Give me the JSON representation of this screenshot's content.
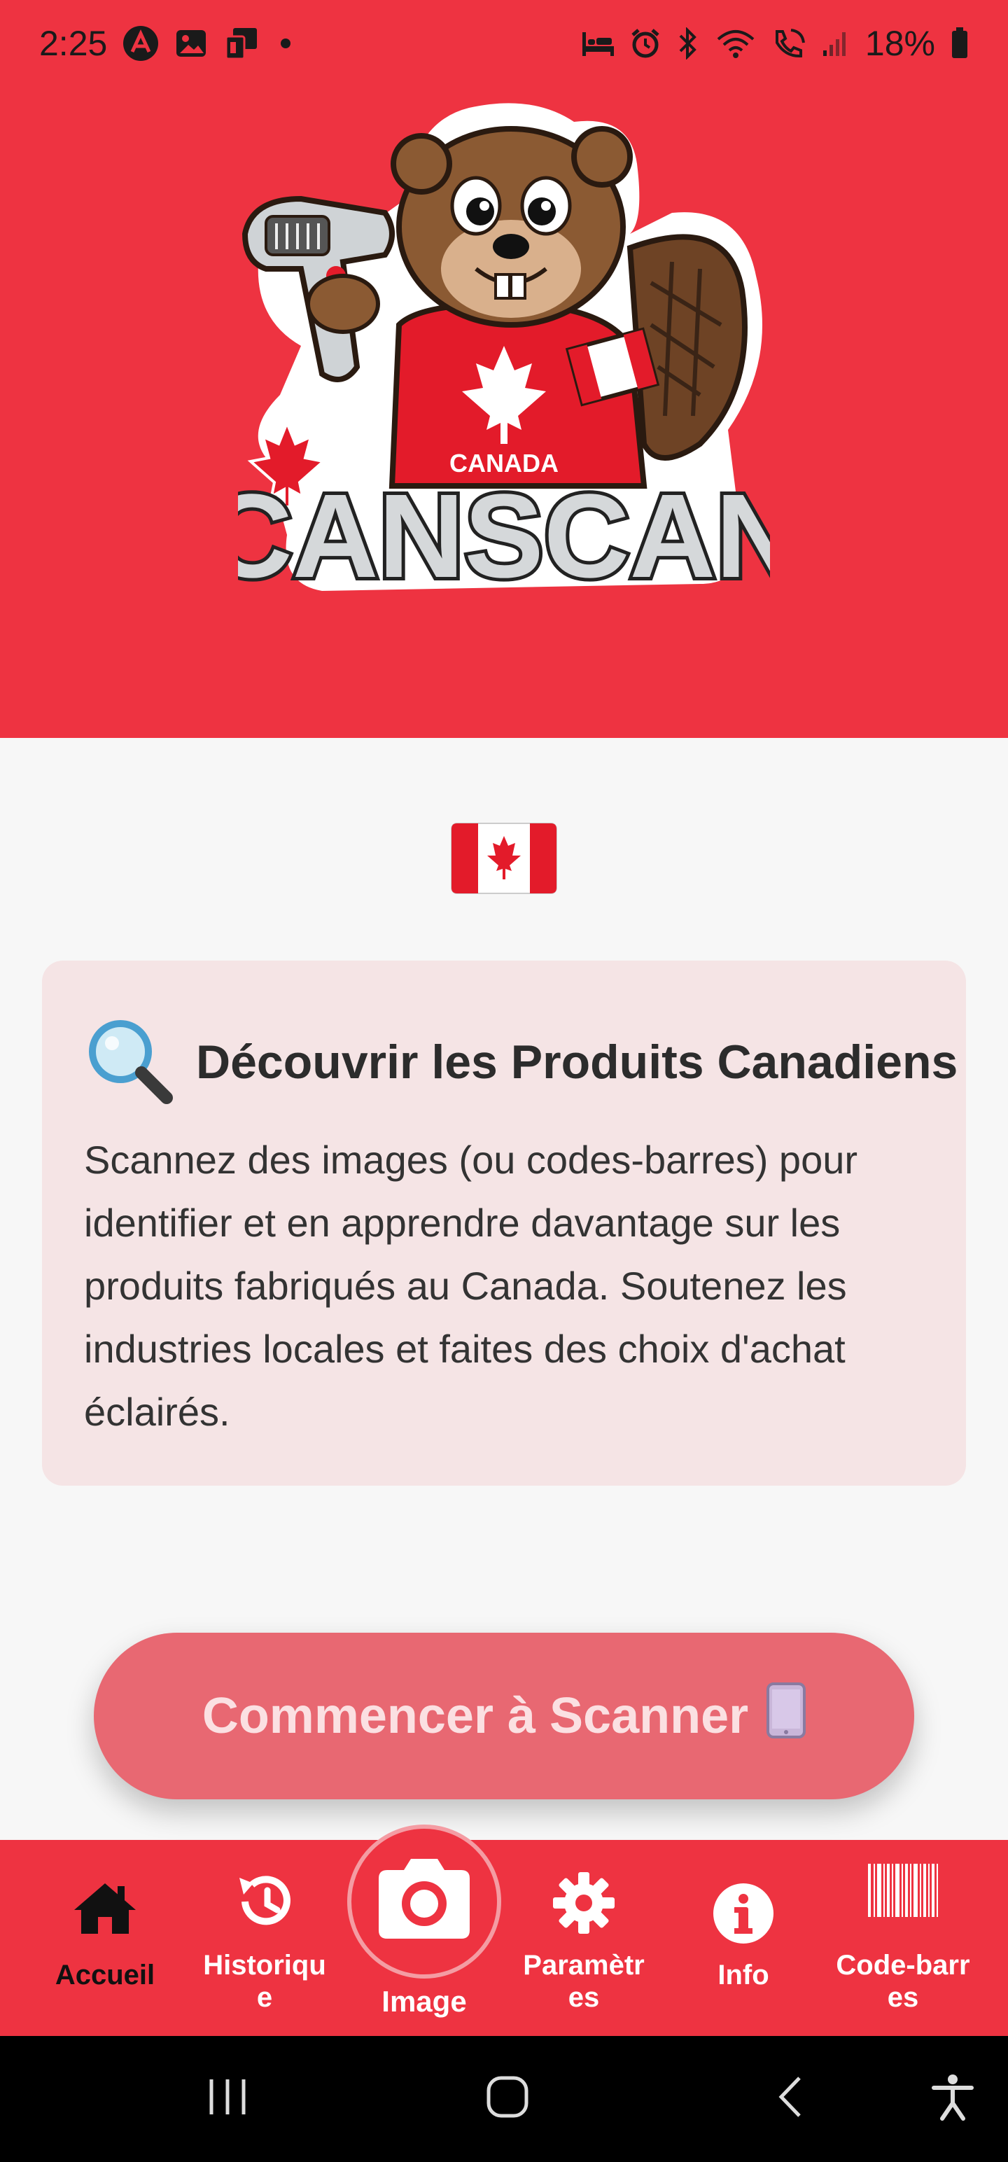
{
  "status_bar": {
    "time": "2:25",
    "battery": "18%",
    "icons_left": [
      "app-a-icon",
      "gallery-icon",
      "cast-icon",
      "dot-icon"
    ],
    "icons_right": [
      "bed-icon",
      "alarm-icon",
      "bluetooth-icon",
      "wifi-icon",
      "wifi-calling-icon",
      "signal-icon",
      "battery-icon"
    ]
  },
  "header": {
    "logo_text": "CANSCAN",
    "logo_shirt_text": "CANADA"
  },
  "card": {
    "icon": "magnifier-icon",
    "title": "Découvrir les Produits Canadiens",
    "body": "Scannez des images (ou codes-barres) pour identifier et en apprendre davantage sur les produits fabriqués au Canada. Soutenez les industries locales et faites des choix d'achat éclairés."
  },
  "cta": {
    "label": "Commencer à Scanner",
    "icon": "phone-icon"
  },
  "tabs": [
    {
      "label": "Accueil",
      "icon": "home-icon",
      "active": true
    },
    {
      "label": "Historique",
      "icon": "history-icon",
      "active": false
    },
    {
      "label": "Image",
      "icon": "camera-icon",
      "active": false
    },
    {
      "label": "Paramètres",
      "icon": "gear-icon",
      "active": false
    },
    {
      "label": "Info",
      "icon": "info-icon",
      "active": false
    },
    {
      "label": "Code-barres",
      "icon": "barcode-icon",
      "active": false
    }
  ],
  "tab_display": {
    "historique_l1": "Historiqu",
    "historique_l2": "e",
    "parametres_l1": "Paramètr",
    "parametres_l2": "es",
    "codebarres_l1": "Code-barr",
    "codebarres_l2": "es"
  },
  "colors": {
    "brand_red": "#ee3341",
    "card_bg": "#f5e4e5",
    "cta_bg": "#e86872",
    "page_bg": "#f7f7f7"
  }
}
